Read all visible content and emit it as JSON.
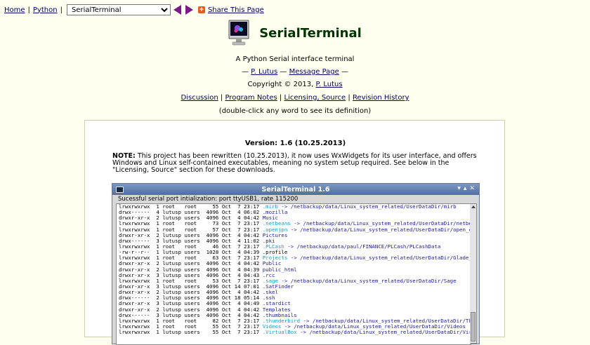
{
  "nav": {
    "home": "Home",
    "python": "Python",
    "selected_page": "SerialTerminal",
    "share": "Share This Page"
  },
  "header": {
    "title": "SerialTerminal",
    "subtitle": "A Python Serial interface terminal",
    "dash_open": "—",
    "author_link": "P. Lutus",
    "dash_mid": "—",
    "message_link": "Message Page",
    "dash_close": "—",
    "copyright_prefix": "Copyright © 2013,",
    "copyright_link": "P. Lutus",
    "links": [
      "Discussion",
      "Program Notes",
      "Licensing, Source",
      "Revision History"
    ],
    "hint": "(double-click any word to see its definition)"
  },
  "content": {
    "version": "Version: 1.6 (10.25.2013)",
    "note_label": "NOTE:",
    "note_text": "This project has been rewritten (10.25.2013), it now uses WxWidgets for its user interface, and offers Windows and Linux self-contained executables, meaning no system setup required. See below in the \"Licensing, Source\" section for these downloads."
  },
  "terminal": {
    "title": "SerialTerminal 1.6",
    "window_buttons": [
      "▾",
      "▴",
      "✕"
    ],
    "status": "Sucessful serial port intialization: port ttyUSB1, rate 115200",
    "lines": [
      {
        "meta": "lrwxrwxrwx  1 root   root     55 Oct  7 23:17 ",
        "name": ".mirb",
        "target": " -> /netbackup/data/Linux_system_related/UserDataDir/mirb",
        "ncolor": "cyan"
      },
      {
        "meta": "drwx------  4 lutusp users  4096 Oct  4 06:02 ",
        "name": ".mozilla",
        "target": "",
        "ncolor": "blue"
      },
      {
        "meta": "drwxr-xr-x  2 lutusp users  4096 Oct  4 04:42 ",
        "name": "Music",
        "target": "",
        "ncolor": "blue"
      },
      {
        "meta": "lrwxrwxrwx  1 root   root     73 Oct  7 23:17 ",
        "name": ".netbeans",
        "target": " -> /netbackup/data/Linux_system_related/UserDataDir/netbeans",
        "ncolor": "cyan"
      },
      {
        "meta": "lrwxrwxrwx  1 root   root     57 Oct  7 23:17 ",
        "name": ".openjpn",
        "target": " -> /netbackup/data/Linux_system_related/UserDataDir/open_cpn",
        "ncolor": "cyan"
      },
      {
        "meta": "drwxr-xr-x  2 lutusp users  4096 Oct  4 04:42 ",
        "name": "Pictures",
        "target": "",
        "ncolor": "blue"
      },
      {
        "meta": "drwx------  3 lutusp users  4096 Oct  4 11:02 ",
        "name": ".pki",
        "target": "",
        "ncolor": "blue"
      },
      {
        "meta": "lrwxrwxrwx  1 root   root     46 Oct  7 23:17 ",
        "name": ".PLCash",
        "target": " -> /netbackup/data/paul/FINANCE/PLCash/PLCashData",
        "ncolor": "cyan"
      },
      {
        "meta": "-rw-r--r--  1 lutusp users  1028 Oct  4 04:39 ",
        "name": ".profile",
        "target": "",
        "ncolor": "plain"
      },
      {
        "meta": "lrwxrwxrwx  1 root   root     63 Oct  7 23:17 ",
        "name": "Projects",
        "target": " -> /netbackup/data/Linux_system_related/UserDataDir/Glade_pro",
        "ncolor": "cyan"
      },
      {
        "meta": "drwxr-xr-x  2 lutusp users  4096 Oct  4 04:42 ",
        "name": "Public",
        "target": "",
        "ncolor": "blue"
      },
      {
        "meta": "drwxr-xr-x  2 lutusp users  4096 Oct  4 04:39 ",
        "name": "public_html",
        "target": "",
        "ncolor": "blue"
      },
      {
        "meta": "drwxr-xr-x  3 lutusp users  4096 Oct  4 04:43 ",
        "name": ".rcc",
        "target": "",
        "ncolor": "blue"
      },
      {
        "meta": "lrwxrwxrwx  1 root   root     53 Oct  7 23:17 ",
        "name": ".sage",
        "target": " -> /netbackup/data/Linux_system_related/UserDataDir/Sage",
        "ncolor": "cyan"
      },
      {
        "meta": "drwxr-xr-x  3 lutusp users  4096 Oct 14 07:01 ",
        "name": ".SatFinder",
        "target": "",
        "ncolor": "blue"
      },
      {
        "meta": "drwxr-xr-x  2 lutusp users  4096 Oct  4 04:42 ",
        "name": ".skel",
        "target": "",
        "ncolor": "blue"
      },
      {
        "meta": "drwx------  2 lutusp users  4096 Oct 18 05:14 ",
        "name": ".ssh",
        "target": "",
        "ncolor": "blue"
      },
      {
        "meta": "drwxr-xr-x  3 lutusp users  4096 Oct  4 04:49 ",
        "name": ".stardict",
        "target": "",
        "ncolor": "blue"
      },
      {
        "meta": "drwxr-xr-x  2 lutusp users  4096 Oct  4 04:42 ",
        "name": "Templates",
        "target": "",
        "ncolor": "blue"
      },
      {
        "meta": "drwx------  3 lutusp users  4096 Oct  4 04:42 ",
        "name": ".thumbnails",
        "target": "",
        "ncolor": "blue"
      },
      {
        "meta": "lrwxrwxrwx  1 root   root     82 Oct  7 23:17 ",
        "name": ".thunderbird",
        "target": " -> /netbackup/data/Linux_system_related/UserDataDir/Thund",
        "ncolor": "cyan"
      },
      {
        "meta": "lrwxrwxrwx  1 root   root     55 Oct  7 23:17 ",
        "name": "Videos",
        "target": " -> /netbackup/data/Linux_system_related/UserDataDir/Videos",
        "ncolor": "cyan"
      },
      {
        "meta": "lrwxrwxrwx  1 lutusp users    55 Oct  7 23:17 ",
        "name": ".VirtualBox",
        "target": " -> /netbackup/data/Linux_system_related/UserDataDir/Virtual",
        "ncolor": "cyan"
      }
    ]
  }
}
